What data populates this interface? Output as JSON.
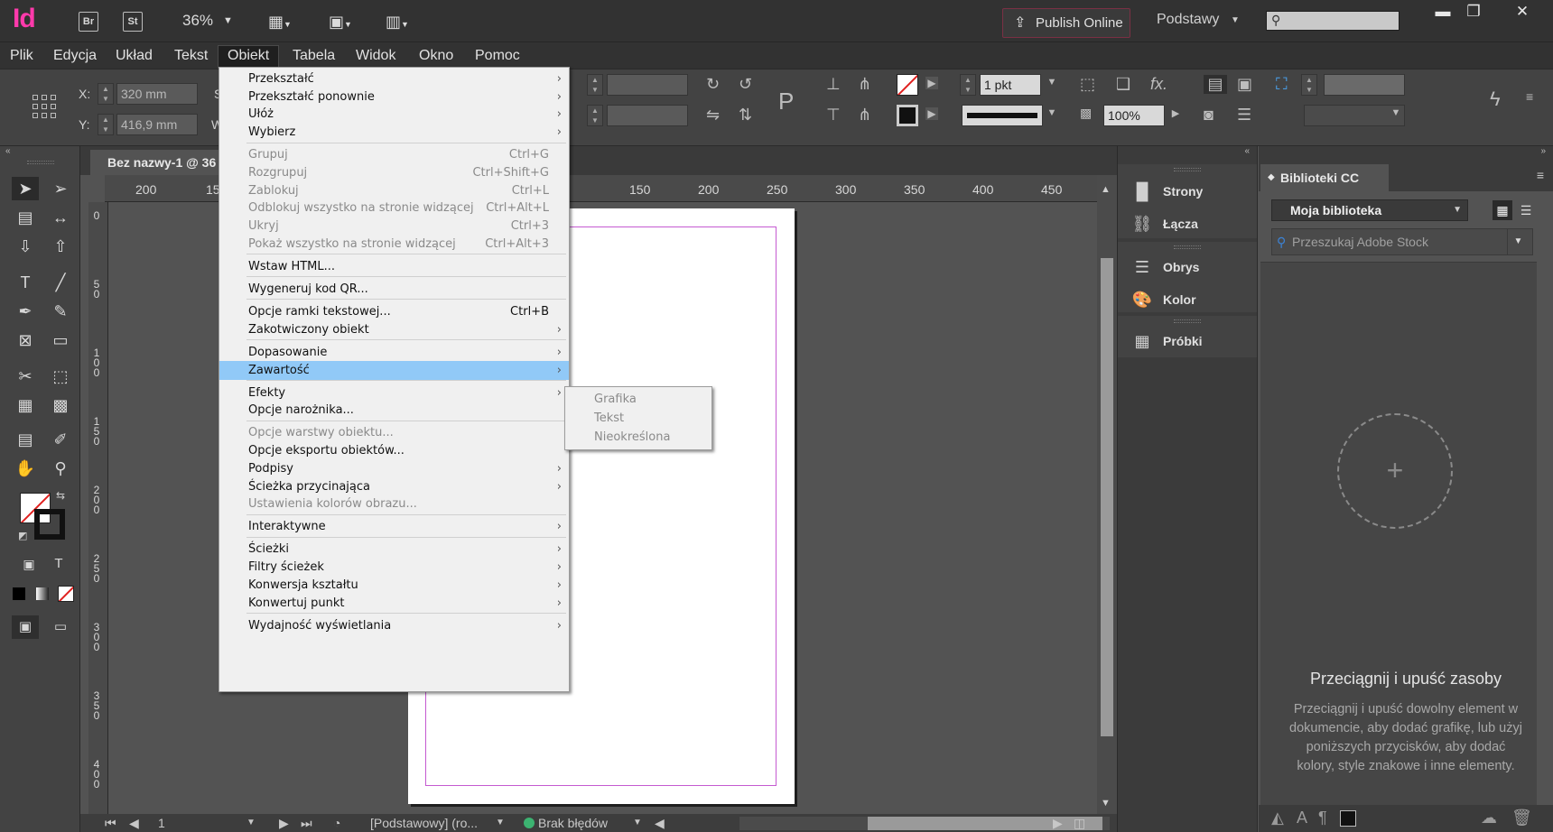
{
  "app": {
    "logo": "Id",
    "bridge_label": "Br",
    "stock_label": "St",
    "zoom": "36%",
    "publish_label": "Publish Online",
    "workspace": "Podstawy"
  },
  "menubar": [
    "Plik",
    "Edycja",
    "Układ",
    "Tekst",
    "Obiekt",
    "Tabela",
    "Widok",
    "Okno",
    "Pomoc"
  ],
  "control": {
    "x_label": "X:",
    "x_value": "320 mm",
    "y_label": "Y:",
    "y_value": "416,9 mm",
    "w_label": "S",
    "h_label": "W",
    "stroke_weight": "1 pkt",
    "opacity": "100%"
  },
  "document": {
    "tab_title": "Bez nazwy-1 @ 36",
    "ruler_h": [
      "200",
      "15",
      "150",
      "200",
      "250",
      "300",
      "350",
      "400",
      "450"
    ],
    "ruler_v": [
      [
        "0"
      ],
      [
        "5",
        "0"
      ],
      [
        "1",
        "0",
        "0"
      ],
      [
        "1",
        "5",
        "0"
      ],
      [
        "2",
        "0",
        "0"
      ],
      [
        "2",
        "5",
        "0"
      ],
      [
        "3",
        "0",
        "0"
      ],
      [
        "3",
        "5",
        "0"
      ],
      [
        "4",
        "0",
        "0"
      ]
    ]
  },
  "status": {
    "page": "1",
    "style": "[Podstawowy] (ro...",
    "preflight": "Brak błędów"
  },
  "object_menu": {
    "groups": [
      [
        {
          "label": "Przekształć",
          "shortcut": "",
          "submenu": true,
          "disabled": false
        },
        {
          "label": "Przekształć ponownie",
          "shortcut": "",
          "submenu": true,
          "disabled": false
        },
        {
          "label": "Ułóż",
          "shortcut": "",
          "submenu": true,
          "disabled": false
        },
        {
          "label": "Wybierz",
          "shortcut": "",
          "submenu": true,
          "disabled": false
        }
      ],
      [
        {
          "label": "Grupuj",
          "shortcut": "Ctrl+G",
          "submenu": false,
          "disabled": true
        },
        {
          "label": "Rozgrupuj",
          "shortcut": "Ctrl+Shift+G",
          "submenu": false,
          "disabled": true
        },
        {
          "label": "Zablokuj",
          "shortcut": "Ctrl+L",
          "submenu": false,
          "disabled": true
        },
        {
          "label": "Odblokuj wszystko na stronie widzącej",
          "shortcut": "Ctrl+Alt+L",
          "submenu": false,
          "disabled": true
        },
        {
          "label": "Ukryj",
          "shortcut": "Ctrl+3",
          "submenu": false,
          "disabled": true
        },
        {
          "label": "Pokaż wszystko na stronie widzącej",
          "shortcut": "Ctrl+Alt+3",
          "submenu": false,
          "disabled": true
        }
      ],
      [
        {
          "label": "Wstaw HTML...",
          "shortcut": "",
          "submenu": false,
          "disabled": false
        }
      ],
      [
        {
          "label": "Wygeneruj kod QR...",
          "shortcut": "",
          "submenu": false,
          "disabled": false
        }
      ],
      [
        {
          "label": "Opcje ramki tekstowej...",
          "shortcut": "Ctrl+B",
          "submenu": false,
          "disabled": false
        },
        {
          "label": "Zakotwiczony obiekt",
          "shortcut": "",
          "submenu": true,
          "disabled": false
        }
      ],
      [
        {
          "label": "Dopasowanie",
          "shortcut": "",
          "submenu": true,
          "disabled": false
        },
        {
          "label": "Zawartość",
          "shortcut": "",
          "submenu": true,
          "disabled": false,
          "highlighted": true
        }
      ],
      [
        {
          "label": "Efekty",
          "shortcut": "",
          "submenu": true,
          "disabled": false
        },
        {
          "label": "Opcje narożnika...",
          "shortcut": "",
          "submenu": false,
          "disabled": false
        }
      ],
      [
        {
          "label": "Opcje warstwy obiektu...",
          "shortcut": "",
          "submenu": false,
          "disabled": true
        },
        {
          "label": "Opcje eksportu obiektów...",
          "shortcut": "",
          "submenu": false,
          "disabled": false
        },
        {
          "label": "Podpisy",
          "shortcut": "",
          "submenu": true,
          "disabled": false
        },
        {
          "label": "Ścieżka przycinająca",
          "shortcut": "",
          "submenu": true,
          "disabled": false
        },
        {
          "label": "Ustawienia kolorów obrazu...",
          "shortcut": "",
          "submenu": false,
          "disabled": true
        }
      ],
      [
        {
          "label": "Interaktywne",
          "shortcut": "",
          "submenu": true,
          "disabled": false
        }
      ],
      [
        {
          "label": "Ścieżki",
          "shortcut": "",
          "submenu": true,
          "disabled": false
        },
        {
          "label": "Filtry ścieżek",
          "shortcut": "",
          "submenu": true,
          "disabled": false
        },
        {
          "label": "Konwersja kształtu",
          "shortcut": "",
          "submenu": true,
          "disabled": false
        },
        {
          "label": "Konwertuj punkt",
          "shortcut": "",
          "submenu": true,
          "disabled": false
        }
      ],
      [
        {
          "label": "Wydajność wyświetlania",
          "shortcut": "",
          "submenu": true,
          "disabled": false
        }
      ]
    ]
  },
  "content_submenu": [
    "Grafika",
    "Tekst",
    "Nieokreślona"
  ],
  "dock": [
    "Strony",
    "Łącza",
    "Obrys",
    "Kolor",
    "Próbki"
  ],
  "cc_libraries": {
    "tab": "Biblioteki CC",
    "library": "Moja biblioteka",
    "search_placeholder": "Przeszukaj Adobe Stock",
    "plus": "+",
    "drop_title": "Przeciągnij i upuść zasoby",
    "drop_desc": "Przeciągnij i upuść dowolny element w dokumencie, aby dodać grafikę, lub użyj poniższych przycisków, aby dodać kolory, style znakowe i inne elementy.",
    "help": "?"
  },
  "colors": {
    "brand": "#ff3aab",
    "highlight": "#91c9f7",
    "margin_guide": "#c55ad1"
  }
}
